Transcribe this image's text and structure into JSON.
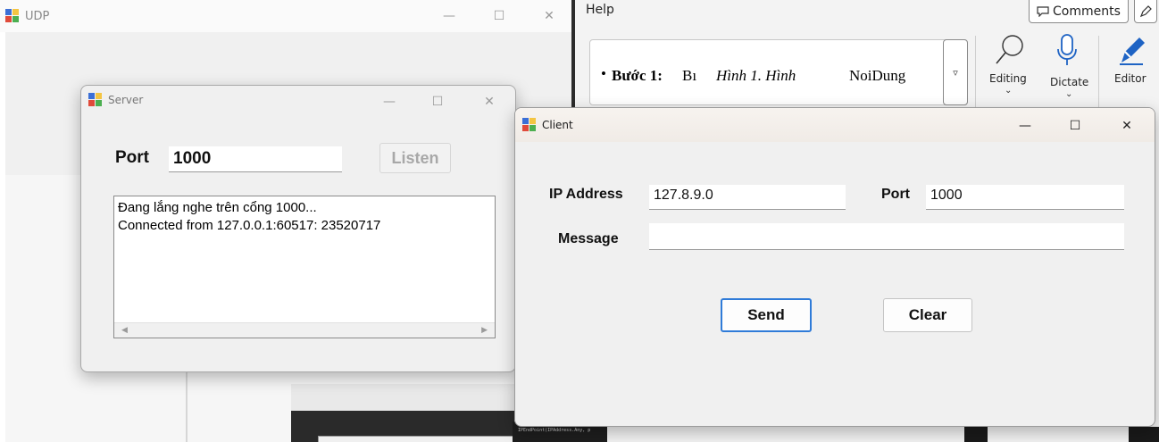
{
  "udp_window": {
    "title": "UDP"
  },
  "word": {
    "menu_help": "Help",
    "comments_label": "Comments",
    "doc_bullet": "•",
    "doc_step": "Bước 1:",
    "doc_trunc": "Bı",
    "doc_caption": "Hình 1. Hình",
    "doc_style": "NoiDung",
    "editing_label": "Editing",
    "dictate_label": "Dictate",
    "editor_label": "Editor"
  },
  "server": {
    "title": "Server",
    "port_label": "Port",
    "port_value": "1000",
    "listen_label": "Listen",
    "log_lines": [
      "Đang lắng nghe trên cổng 1000...",
      "Connected from 127.0.0.1:60517: 23520717"
    ]
  },
  "client": {
    "title": "Client",
    "ip_label": "IP Address",
    "ip_value": "127.8.9.0",
    "port_label": "Port",
    "port_value": "1000",
    "message_label": "Message",
    "message_value": "",
    "send_label": "Send",
    "clear_label": "Clear"
  },
  "code_snippet": "IPEndPoint(IPAddress.Any, p",
  "colors": {
    "window_bg": "#f0f0f0",
    "accent_blue": "#2f7bd8",
    "word_bg": "#f3f3f3"
  }
}
